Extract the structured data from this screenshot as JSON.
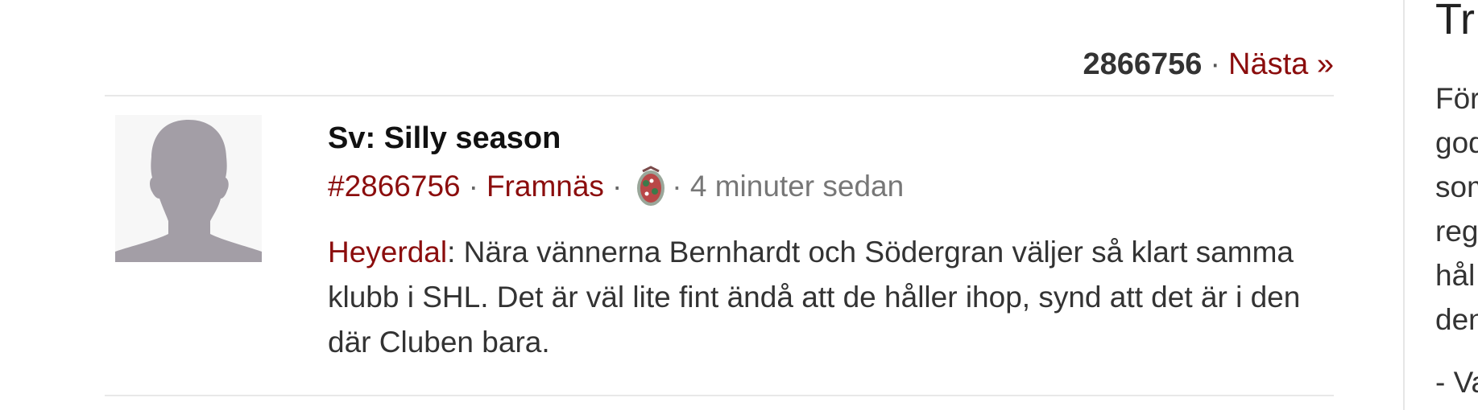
{
  "pager": {
    "current": "2866756",
    "separator": "·",
    "next_label": "Nästa »"
  },
  "post": {
    "title": "Sv: Silly season",
    "id_link": "#2866756",
    "author": "Framnäs",
    "separator": "·",
    "time": "· 4 minuter sedan",
    "quote_author": "Heyerdal",
    "text": ": Nära vännerna Bernhardt och Södergran väljer så klart samma klubb i SHL. Det är väl lite fint ändå att de håller ihop, synd att det är i den där Cluben bara."
  },
  "sidebar": {
    "title": "Tr",
    "lines": [
      "För",
      "god",
      "som",
      "reg",
      "hål",
      "den"
    ],
    "signature": "- Va"
  },
  "colors": {
    "link": "#8b0d0d",
    "text": "#333333",
    "muted": "#777777",
    "avatar_silhouette": "#a39ea6"
  },
  "icons": {
    "avatar": "default-user-silhouette",
    "team_logo": "team-logo-icon"
  }
}
